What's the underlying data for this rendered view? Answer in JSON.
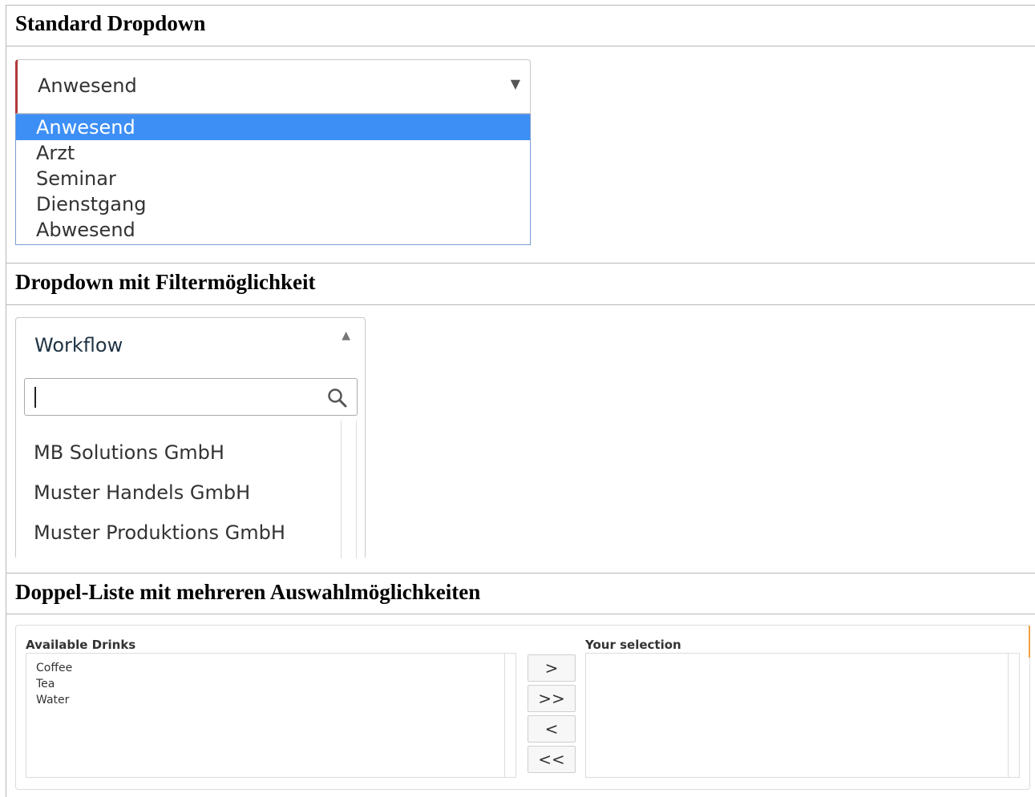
{
  "sections": {
    "standard": {
      "title": "Standard Dropdown",
      "selected": "Anwesend",
      "options": [
        "Anwesend",
        "Arzt",
        "Seminar",
        "Dienstgang",
        "Abwesend"
      ]
    },
    "filter": {
      "title": "Dropdown mit Filtermöglichkeit",
      "selected": "Workflow",
      "search_value": "",
      "items": [
        "MB Solutions GmbH",
        "Muster Handels GmbH",
        "Muster Produktions GmbH"
      ]
    },
    "dual_list": {
      "title": "Doppel-Liste mit mehreren Auswahlmöglichkeiten",
      "available_label": "Available Drinks",
      "selection_label": "Your selection",
      "available": [
        "Coffee",
        "Tea",
        "Water"
      ],
      "selected": [],
      "buttons": {
        "move_one": ">",
        "move_all": ">>",
        "remove_one": "<",
        "remove_all": "<<"
      }
    }
  },
  "colors": {
    "highlight": "#3d8ff5",
    "invalid_border": "#b03a3a",
    "accent": "#f0a24a"
  },
  "icons": {
    "caret_down": "▼",
    "caret_up": "▲",
    "search": "search-icon"
  }
}
